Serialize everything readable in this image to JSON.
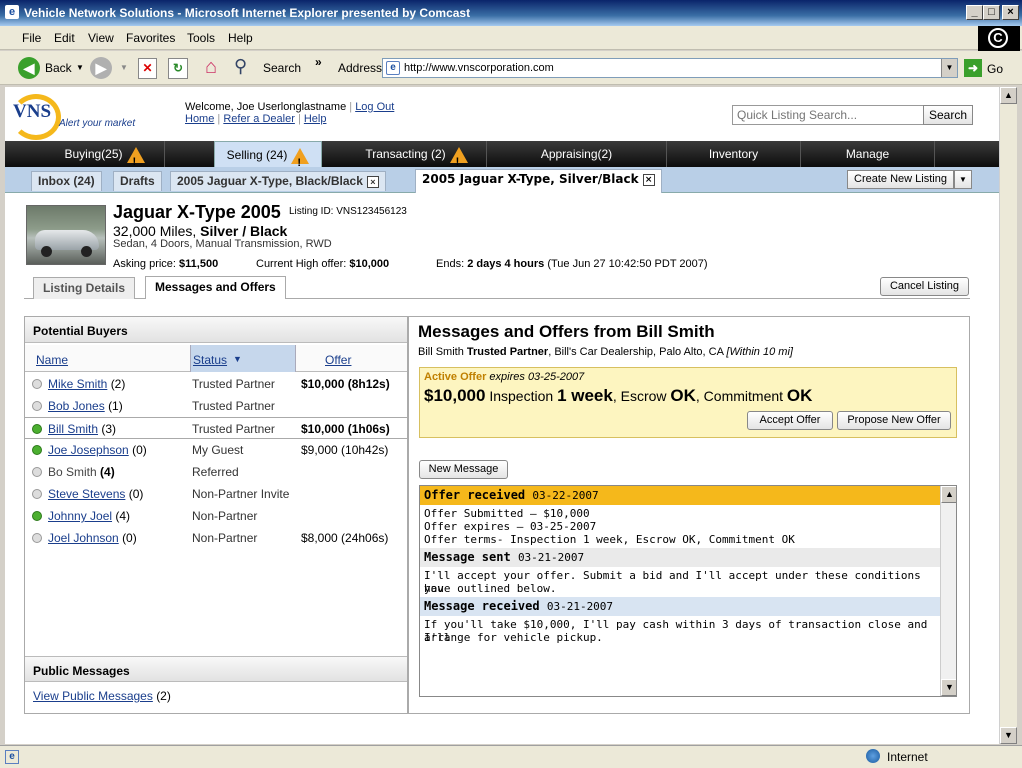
{
  "window": {
    "title": "Vehicle Network Solutions - Microsoft Internet Explorer presented by Comcast"
  },
  "menu": [
    "File",
    "Edit",
    "View",
    "Favorites",
    "Tools",
    "Help"
  ],
  "toolbar": {
    "back": "Back",
    "search": "Search",
    "address_label": "Address",
    "url": "http://www.vnscorporation.com",
    "go": "Go"
  },
  "site": {
    "logo": "VNS",
    "tagline": "Alert your market",
    "welcome": "Welcome, Joe Userlonglastname",
    "logout": "Log Out",
    "links": [
      "Home",
      "Refer a Dealer",
      "Help"
    ],
    "search_placeholder": "Quick Listing Search...",
    "search_btn": "Search"
  },
  "nav": [
    {
      "label": "Buying",
      "count": "(25)",
      "warn": true
    },
    {
      "label": "Selling",
      "count": "(24)",
      "warn": true
    },
    {
      "label": "Transacting",
      "count": "(2)",
      "warn": true
    },
    {
      "label": "Appraising",
      "count": "(2)",
      "warn": false
    },
    {
      "label": "Inventory",
      "count": "",
      "warn": false
    },
    {
      "label": "Manage",
      "count": "",
      "warn": false
    }
  ],
  "subtabs": {
    "inbox": "Inbox (24)",
    "drafts": "Drafts",
    "tab1": "2005 Jaguar X-Type, Black/Black",
    "tab2": "2005 Jaguar X-Type, Silver/Black",
    "create": "Create New Listing"
  },
  "listing": {
    "title": "Jaguar X-Type 2005",
    "id_label": "Listing ID:",
    "id": "VNS123456123",
    "miles": "32,000 Miles,",
    "color": "Silver / Black",
    "specs": "Sedan, 4 Doors, Manual Transmission, RWD",
    "ask_label": "Asking price:",
    "ask": "$11,500",
    "high_label": "Current High offer:",
    "high": "$10,000",
    "ends_label": "Ends:",
    "ends": "2 days 4 hours",
    "ends_date": "(Tue Jun 27 10:42:50 PDT 2007)"
  },
  "detail_tabs": {
    "details": "Listing Details",
    "messages": "Messages and Offers",
    "cancel": "Cancel Listing"
  },
  "buyers": {
    "title": "Potential Buyers",
    "cols": {
      "name": "Name",
      "status": "Status",
      "offer": "Offer"
    },
    "rows": [
      {
        "name": "Mike Smith",
        "count": "(2)",
        "status": "Trusted Partner",
        "offer": "$10,000 (8h12s)",
        "online": false,
        "bold": true,
        "link": true
      },
      {
        "name": "Bob Jones",
        "count": "(1)",
        "status": "Trusted Partner",
        "offer": "",
        "online": false,
        "bold": false,
        "link": true
      },
      {
        "name": "Bill Smith",
        "count": "(3)",
        "status": "Trusted Partner",
        "offer": "$10,000 (1h06s)",
        "online": true,
        "bold": true,
        "link": true
      },
      {
        "name": "Joe Josephson",
        "count": "(0)",
        "status": "My Guest",
        "offer": "$9,000 (10h42s)",
        "online": true,
        "bold": false,
        "link": true
      },
      {
        "name": "Bo Smith",
        "count": "(4)",
        "status": "Referred",
        "offer": "",
        "online": false,
        "bold": false,
        "link": false
      },
      {
        "name": "Steve Stevens",
        "count": "(0)",
        "status": "Non-Partner Invite",
        "offer": "",
        "online": false,
        "bold": false,
        "link": true
      },
      {
        "name": "Johnny Joel",
        "count": "(4)",
        "status": "Non-Partner",
        "offer": "",
        "online": true,
        "bold": false,
        "link": true
      },
      {
        "name": "Joel Johnson",
        "count": "(0)",
        "status": "Non-Partner",
        "offer": "$8,000 (24h06s)",
        "online": false,
        "bold": false,
        "link": true
      }
    ],
    "public_title": "Public Messages",
    "public_link": "View Public Messages",
    "public_count": "(2)"
  },
  "messages": {
    "title": "Messages and Offers from Bill Smith",
    "sub_name": "Bill Smith",
    "sub_status": "Trusted Partner",
    "sub_rest": ", Bill's Car Dealership, Palo Alto, CA",
    "sub_dist": "[Within 10 mi]",
    "offer": {
      "label": "Active Offer",
      "expires": "expires 03-25-2007",
      "amount": "$10,000",
      "insp_l": "Inspection",
      "insp": "1 week",
      "esc_l": ", Escrow",
      "esc": "OK",
      "com_l": ", Commitment",
      "com": "OK",
      "accept": "Accept Offer",
      "propose": "Propose New Offer"
    },
    "new_btn": "New Message",
    "thread": [
      {
        "type": "Offer received",
        "date": "03-22-2007",
        "lines": [
          "Offer Submitted – $10,000",
          "Offer expires – 03-25-2007",
          "Offer terms- Inspection 1 week, Escrow OK, Commitment OK"
        ]
      },
      {
        "type": "Message sent",
        "date": "03-21-2007",
        "lines": [
          "I'll accept your offer. Submit a bid and I'll accept under these conditions you",
          "have outlined below."
        ]
      },
      {
        "type": "Message received",
        "date": "03-21-2007",
        "lines": [
          "If you'll take $10,000, I'll pay cash within 3 days of transaction close and I'll",
          "arrange for vehicle pickup."
        ]
      }
    ]
  },
  "status": {
    "zone": "Internet"
  },
  "colors": {
    "accent": "#1a3e8c",
    "offer_bg": "#fdf5c0",
    "offer_header": "#f5b81b"
  }
}
